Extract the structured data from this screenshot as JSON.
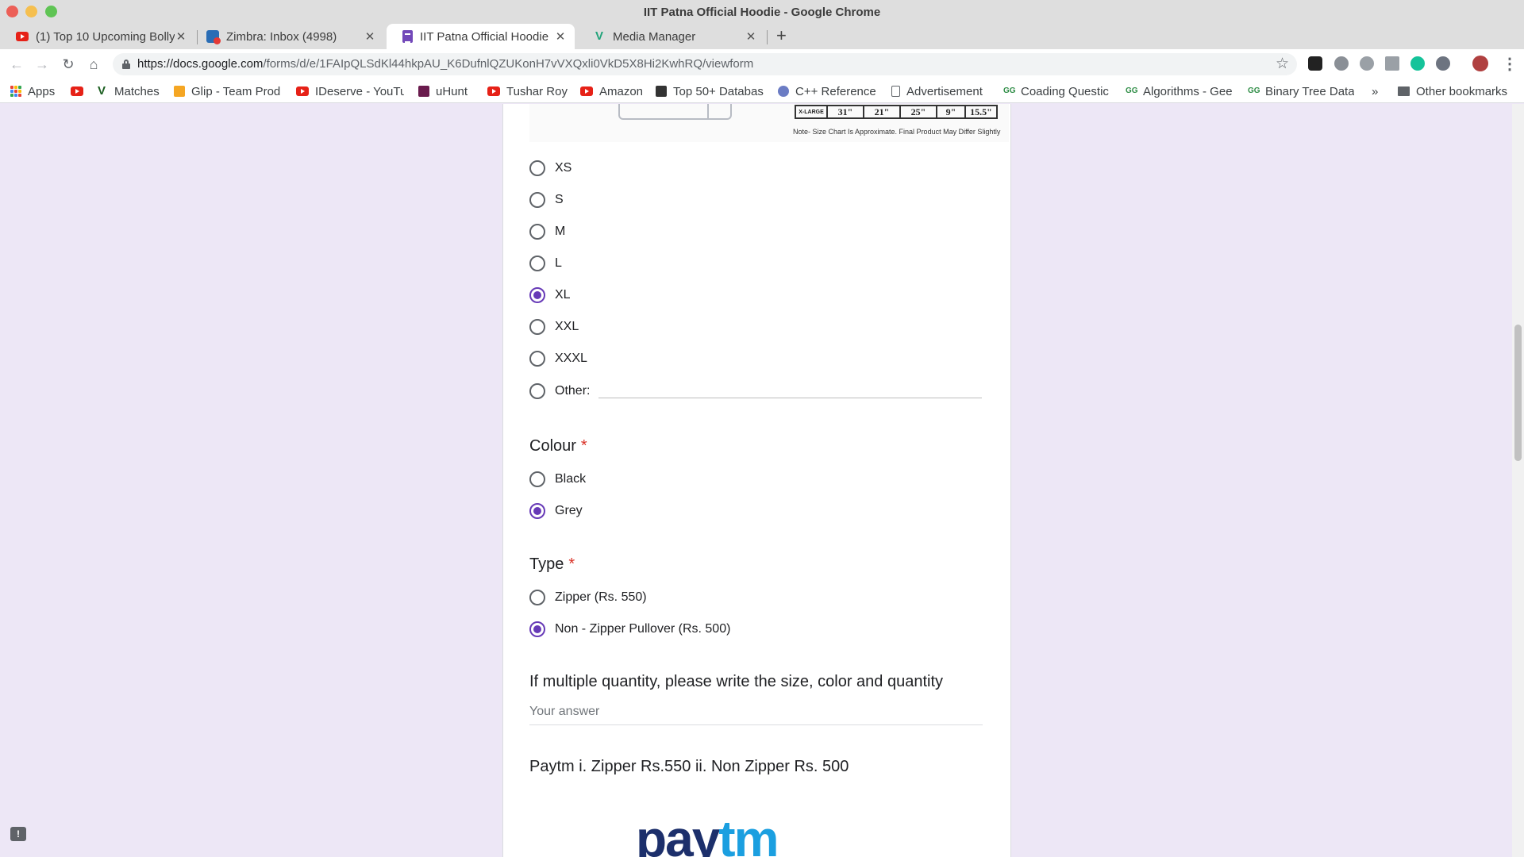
{
  "window": {
    "title": "IIT Patna Official Hoodie - Google Chrome"
  },
  "tabs": [
    {
      "label": "(1) Top 10 Upcoming Bolly",
      "favicon": "youtube-icon"
    },
    {
      "label": "Zimbra: Inbox (4998)",
      "favicon": "zimbra-icon"
    },
    {
      "label": "IIT Patna Official Hoodie",
      "favicon": "google-forms-icon",
      "active": true
    },
    {
      "label": "Media Manager",
      "favicon": "vuetify-icon"
    }
  ],
  "toolbar": {
    "url_host": "https://docs.google.com",
    "url_path": "/forms/d/e/1FAIpQLSdKl44hkpAU_K6DufnlQZUKonH7vVXQxli0VkD5X8Hi2KwhRQ/viewform"
  },
  "bookmarks": [
    {
      "label": "Apps",
      "icon": "apps-icon"
    },
    {
      "label": "",
      "icon": "youtube-icon"
    },
    {
      "label": "Matches",
      "icon": "vuetify-icon"
    },
    {
      "label": "Glip - Team Prod",
      "icon": "glip-icon"
    },
    {
      "label": "IDeserve - YouTu",
      "icon": "youtube-icon"
    },
    {
      "label": "uHunt",
      "icon": "uva-icon"
    },
    {
      "label": "Tushar Roy",
      "icon": "youtube-icon"
    },
    {
      "label": "Amazon",
      "icon": "youtube-icon"
    },
    {
      "label": "Top 50+ Databas",
      "icon": "book-icon"
    },
    {
      "label": "C++ Reference",
      "icon": "cpp-icon"
    },
    {
      "label": "Advertisement",
      "icon": "page-icon"
    },
    {
      "label": "Coading Questic",
      "icon": "gfg-icon"
    },
    {
      "label": "Algorithms - Gee",
      "icon": "gfg-icon"
    },
    {
      "label": "Binary Tree Data",
      "icon": "gfg-icon"
    }
  ],
  "bookmarks_overflow": "»",
  "other_bookmarks": "Other bookmarks",
  "size_chart": {
    "row_label": "X-LARGE",
    "values": [
      "31\"",
      "21\"",
      "25\"",
      "9\"",
      "15.5\""
    ],
    "note": "Note- Size Chart Is Approximate. Final Product May Differ Slightly"
  },
  "size_options": [
    {
      "label": "XS",
      "selected": false
    },
    {
      "label": "S",
      "selected": false
    },
    {
      "label": "M",
      "selected": false
    },
    {
      "label": "L",
      "selected": false
    },
    {
      "label": "XL",
      "selected": true
    },
    {
      "label": "XXL",
      "selected": false
    },
    {
      "label": "XXXL",
      "selected": false
    },
    {
      "label": "Other:",
      "selected": false
    }
  ],
  "colour_question": {
    "title": "Colour",
    "required_mark": "*",
    "options": [
      {
        "label": "Black",
        "selected": false
      },
      {
        "label": "Grey",
        "selected": true
      }
    ]
  },
  "type_question": {
    "title": "Type",
    "required_mark": "*",
    "options": [
      {
        "label": "Zipper (Rs. 550)",
        "selected": false
      },
      {
        "label": "Non - Zipper Pullover (Rs. 500)",
        "selected": true
      }
    ]
  },
  "multi_question": {
    "title": "If multiple quantity, please write the size, color and quantity",
    "placeholder": "Your answer"
  },
  "payment": {
    "title": "Paytm i. Zipper Rs.550 ii. Non Zipper Rs. 500",
    "logo_text_a": "pay",
    "logo_text_b": "tm"
  },
  "colors": {
    "accent": "#673ab7",
    "page_bg": "#ede7f6",
    "required": "#d93025"
  }
}
